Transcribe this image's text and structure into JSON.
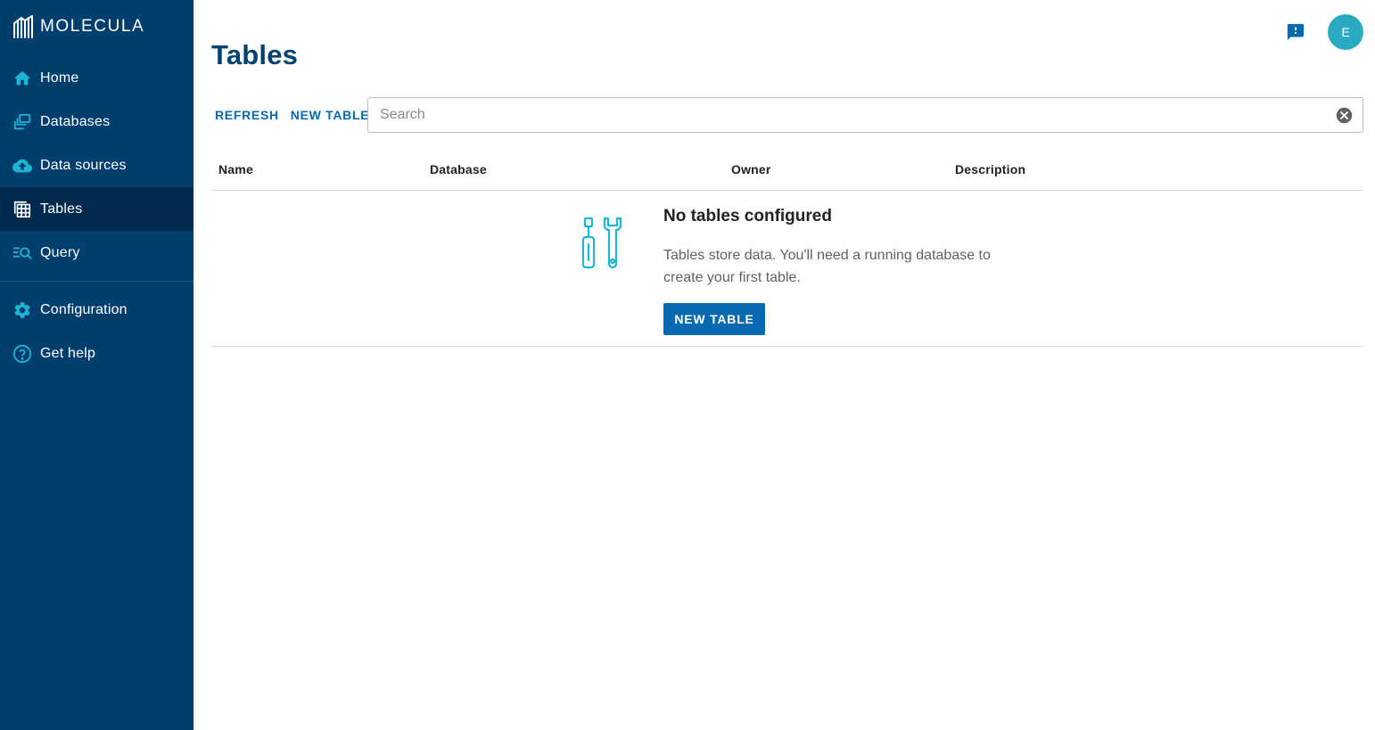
{
  "app": {
    "logo_text": "MOLECULA",
    "logo_icon": "molecula-logo-icon"
  },
  "sidebar": {
    "items": [
      {
        "label": "Home",
        "icon": "home-icon",
        "active": false
      },
      {
        "label": "Databases",
        "icon": "databases-icon",
        "active": false
      },
      {
        "label": "Data sources",
        "icon": "cloud-upload-icon",
        "active": false
      },
      {
        "label": "Tables",
        "icon": "table-icon",
        "active": true
      },
      {
        "label": "Query",
        "icon": "query-icon",
        "active": false
      },
      {
        "label": "Configuration",
        "icon": "gear-icon",
        "active": false
      },
      {
        "label": "Get help",
        "icon": "help-icon",
        "active": false
      }
    ]
  },
  "header": {
    "title": "Tables",
    "avatar_initial": "E",
    "feedback_icon": "feedback-icon"
  },
  "toolbar": {
    "refresh_label": "REFRESH",
    "new_table_label": "NEW TABLE"
  },
  "search": {
    "placeholder": "Search",
    "value": ""
  },
  "table": {
    "columns": [
      "Name",
      "Database",
      "Owner",
      "Description"
    ]
  },
  "empty_state": {
    "title": "No tables configured",
    "description": "Tables store data. You'll need a running database to create your first table.",
    "button_label": "NEW TABLE",
    "illustration": "tools-icon"
  },
  "colors": {
    "sidebar_bg": "#003e6e",
    "sidebar_active_bg": "#002a4d",
    "accent": "#0769b0",
    "title": "#00416f",
    "avatar_bg": "#2aaac0",
    "icon_cyan": "#1eb4d4"
  }
}
